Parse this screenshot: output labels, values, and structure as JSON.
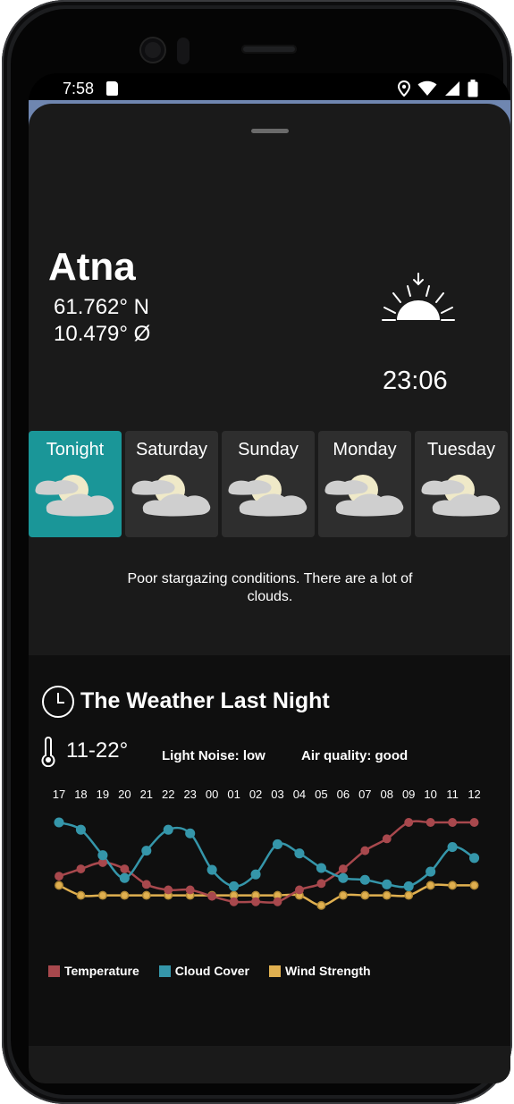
{
  "status_bar": {
    "time": "7:58",
    "icons": [
      "sd-card-icon",
      "location-icon",
      "wifi-icon",
      "signal-icon",
      "battery-icon"
    ]
  },
  "location": {
    "name": "Atna",
    "latitude": "61.762° N",
    "longitude": "10.479° Ø"
  },
  "sunset": {
    "icon": "sunset-icon",
    "time": "23:06"
  },
  "days": [
    {
      "label": "Tonight",
      "active": true,
      "icon": "cloudy-moon-icon"
    },
    {
      "label": "Saturday",
      "active": false,
      "icon": "cloudy-moon-icon"
    },
    {
      "label": "Sunday",
      "active": false,
      "icon": "cloudy-moon-icon"
    },
    {
      "label": "Monday",
      "active": false,
      "icon": "cloudy-moon-icon"
    },
    {
      "label": "Tuesday",
      "active": false,
      "icon": "cloudy-moon-icon"
    }
  ],
  "condition_text": "Poor stargazing conditions. There are a lot of clouds.",
  "last_night": {
    "title": "The Weather Last Night",
    "temperature_range": "11-22°",
    "light_noise": "Light Noise: low",
    "air_quality": "Air quality: good"
  },
  "colors": {
    "accent": "#1a9698",
    "temperature": "#a8484d",
    "cloud_cover": "#3596aa",
    "wind_strength": "#e0b050"
  },
  "chart_data": {
    "type": "line",
    "x": [
      "17",
      "18",
      "19",
      "20",
      "21",
      "22",
      "23",
      "00",
      "01",
      "02",
      "03",
      "04",
      "05",
      "06",
      "07",
      "08",
      "09",
      "10",
      "11",
      "12"
    ],
    "ylim": [
      0,
      100
    ],
    "grid": false,
    "legend_position": "bottom-left",
    "series": [
      {
        "name": "Temperature",
        "values": [
          41,
          49,
          56,
          49,
          32,
          26,
          26,
          19,
          13,
          13,
          13,
          26,
          33,
          49,
          69,
          82,
          100,
          100,
          100,
          100
        ]
      },
      {
        "name": "Cloud Cover",
        "values": [
          100,
          92,
          64,
          39,
          69,
          92,
          88,
          48,
          30,
          43,
          76,
          66,
          50,
          39,
          37,
          32,
          30,
          46,
          73,
          61
        ]
      },
      {
        "name": "Wind Strength",
        "values": [
          31,
          20,
          20,
          20,
          20,
          20,
          20,
          20,
          20,
          20,
          20,
          20,
          9,
          20,
          20,
          20,
          20,
          31,
          31,
          31
        ]
      }
    ]
  }
}
